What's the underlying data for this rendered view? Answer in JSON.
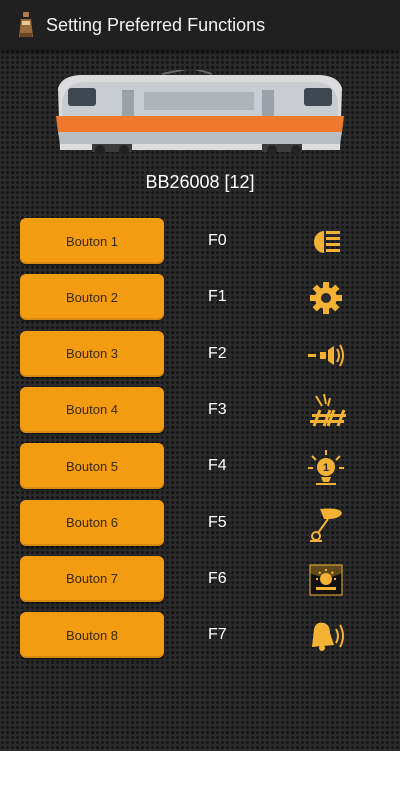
{
  "app": {
    "title": "Setting Preferred Functions"
  },
  "loco": {
    "name": "BB26008 [12]"
  },
  "functions": [
    {
      "button": "Bouton 1",
      "fn": "F0",
      "icon": "headlight-icon"
    },
    {
      "button": "Bouton 2",
      "fn": "F1",
      "icon": "gear-icon"
    },
    {
      "button": "Bouton 3",
      "fn": "F2",
      "icon": "horn-sound-icon"
    },
    {
      "button": "Bouton 4",
      "fn": "F3",
      "icon": "pantograph-rails-icon"
    },
    {
      "button": "Bouton 5",
      "fn": "F4",
      "icon": "light-1-icon"
    },
    {
      "button": "Bouton 6",
      "fn": "F5",
      "icon": "whistle-icon"
    },
    {
      "button": "Bouton 7",
      "fn": "F6",
      "icon": "cab-light-icon"
    },
    {
      "button": "Bouton 8",
      "fn": "F7",
      "icon": "bell-icon"
    }
  ],
  "colors": {
    "accent": "#f39c12",
    "icon": "#f3b233",
    "background": "#2a2a2a",
    "appbar": "#202020"
  }
}
